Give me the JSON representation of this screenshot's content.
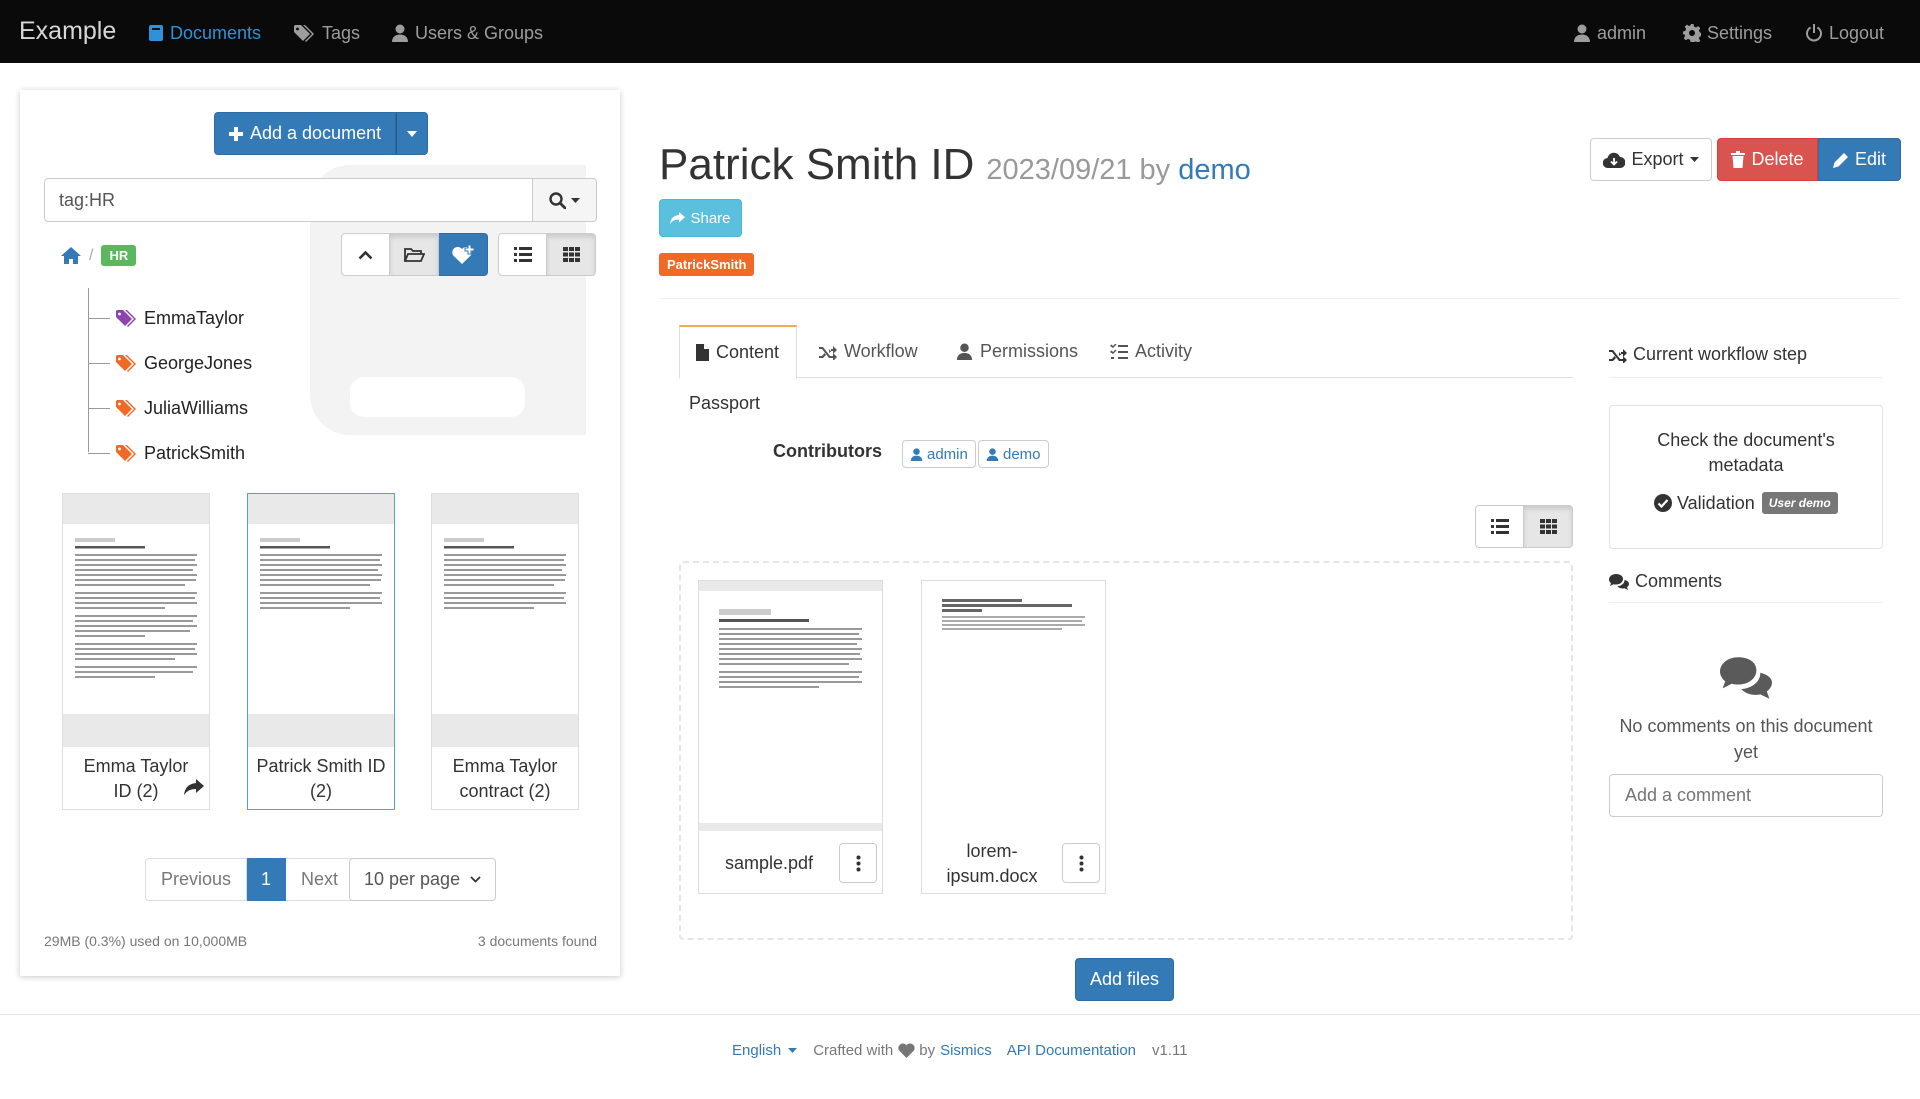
{
  "navbar": {
    "brand": "Example",
    "items": [
      {
        "label": "Documents",
        "icon": "book-icon",
        "active": true
      },
      {
        "label": "Tags",
        "icon": "tags-icon"
      },
      {
        "label": "Users & Groups",
        "icon": "user-icon"
      }
    ],
    "right": [
      {
        "label": "admin",
        "icon": "user-icon"
      },
      {
        "label": "Settings",
        "icon": "gear-icon"
      },
      {
        "label": "Logout",
        "icon": "power-icon"
      }
    ]
  },
  "sidebar": {
    "add_document_label": "Add a document",
    "search_value": "tag:HR",
    "breadcrumb": {
      "tag": "HR"
    },
    "tags": [
      {
        "name": "EmmaTaylor",
        "color": "#8e44ad"
      },
      {
        "name": "GeorgeJones",
        "color": "#f06a26"
      },
      {
        "name": "JuliaWilliams",
        "color": "#f06a26"
      },
      {
        "name": "PatrickSmith",
        "color": "#f06a26"
      }
    ],
    "documents": [
      {
        "title_line1": "Emma Taylor",
        "title_line2": "ID (2)",
        "shared": true
      },
      {
        "title_line1": "Patrick Smith ID",
        "title_line2": "(2)",
        "selected": true
      },
      {
        "title_line1": "Emma Taylor",
        "title_line2": "contract (2)"
      }
    ],
    "pagination": {
      "previous": "Previous",
      "page": "1",
      "next": "Next",
      "per_page": "10 per page"
    },
    "storage": "29MB (0.3%) used on 10,000MB",
    "found": "3 documents found"
  },
  "document": {
    "title": "Patrick Smith ID",
    "date": "2023/09/21",
    "by": "by",
    "creator": "demo",
    "share_label": "Share",
    "tag": "PatrickSmith",
    "tag_color": "#f06a26",
    "actions": {
      "export": "Export",
      "delete": "Delete",
      "edit": "Edit"
    },
    "tabs": [
      "Content",
      "Workflow",
      "Permissions",
      "Activity"
    ],
    "description": "Passport",
    "contributors_label": "Contributors",
    "contributors": [
      "admin",
      "demo"
    ],
    "files": [
      {
        "name_line1": "sample.pdf",
        "name_line2": ""
      },
      {
        "name_line1": "lorem-",
        "name_line2": "ipsum.docx"
      }
    ],
    "add_files_label": "Add files"
  },
  "workflow": {
    "heading": "Current workflow step",
    "step_line1": "Check the document's",
    "step_line2": "metadata",
    "validation_label": "Validation",
    "assignee": "User demo"
  },
  "comments": {
    "heading": "Comments",
    "empty_line1": "No comments on this document",
    "empty_line2": "yet",
    "placeholder": "Add a comment"
  },
  "footer": {
    "language": "English",
    "crafted": "Crafted with",
    "by": "by",
    "company": "Sismics",
    "api_docs": "API Documentation",
    "version": "v1.11"
  },
  "colors": {
    "primary": "#337ab7",
    "danger": "#d9534f",
    "info": "#5bc0de",
    "success": "#5cb85c",
    "navbar": "#0a0a0a"
  }
}
